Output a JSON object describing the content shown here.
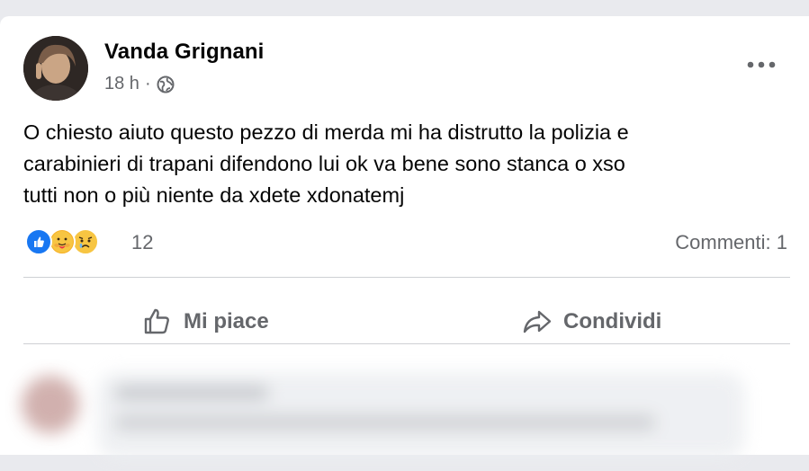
{
  "post": {
    "author": "Vanda Grignani",
    "time": "18 h",
    "separator": "·",
    "audience_icon": "globe-icon",
    "more_icon": "more-options-icon",
    "text": "O chiesto aiuto questo pezzo di merda mi ha distrutto la polizia e\ncarabinieri di trapani difendono lui ok va bene sono stanca o xso\ntutti non o più niente da xdete xdonatemj",
    "reactions": {
      "icons": [
        "like-reaction-icon",
        "care-reaction-icon",
        "sad-reaction-icon"
      ],
      "count": "12"
    },
    "comments_label": "Commenti: 1"
  },
  "actions": {
    "like_label": "Mi piace",
    "share_label": "Condividi"
  },
  "colors": {
    "like_blue": "#1877f2",
    "secondary_text": "#65676b",
    "primary_text": "#050505",
    "divider": "#ced0d4"
  }
}
